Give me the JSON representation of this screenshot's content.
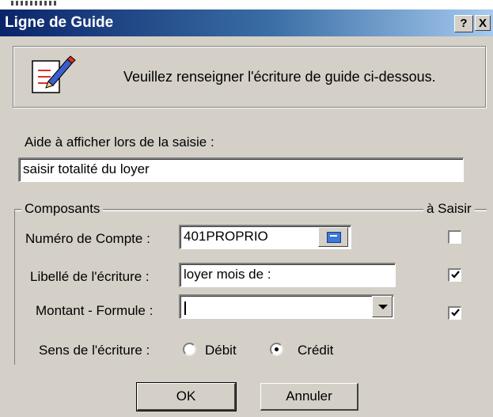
{
  "window": {
    "title": "Ligne de Guide",
    "help_label": "?",
    "close_label": "X"
  },
  "header": {
    "message": "Veuillez renseigner l'écriture de guide ci-dessous.",
    "icon": "edit-document-icon"
  },
  "aide": {
    "label": "Aide à afficher lors de la saisie :",
    "value": "saisir totalité du loyer"
  },
  "composants": {
    "group_label": "Composants",
    "a_saisir_label": "à Saisir",
    "compte": {
      "label": "Numéro de Compte :",
      "value": "401PROPRIO",
      "a_saisir": false,
      "lookup_icon": "lookup-icon"
    },
    "libelle": {
      "label": "Libellé de l'écriture :",
      "value": "loyer mois de :",
      "a_saisir": true
    },
    "montant": {
      "label": "Montant - Formule :",
      "value": "",
      "a_saisir": true
    },
    "sens": {
      "label": "Sens de l'écriture :",
      "options": [
        {
          "label": "Débit",
          "selected": false
        },
        {
          "label": "Crédit",
          "selected": true
        }
      ]
    }
  },
  "buttons": {
    "ok": "OK",
    "cancel": "Annuler"
  },
  "colors": {
    "dialog_bg": "#d4d0c8",
    "title_start": "#0a246a",
    "title_end": "#a6caf0"
  }
}
